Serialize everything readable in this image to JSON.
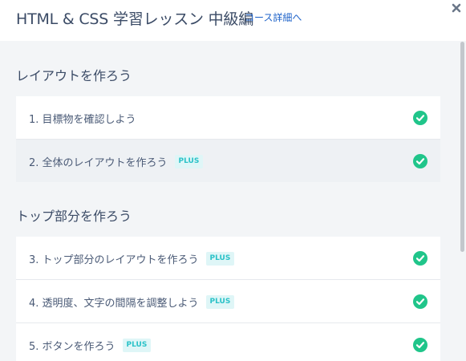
{
  "header": {
    "title": "HTML & CSS 学習レッスン 中級編",
    "course_link": "コース詳細へ",
    "close_icon": "close-icon"
  },
  "colors": {
    "accent_link": "#1f63c9",
    "check_green": "#20c58a",
    "plus_badge_text": "#2bc2c8",
    "plus_badge_bg": "#dff6f7"
  },
  "chapters": [
    {
      "title": "レイアウトを作ろう",
      "lessons": [
        {
          "label": "1. 目標物を確認しよう",
          "plus": "",
          "status_icon": "check-circle-icon"
        },
        {
          "label": "2. 全体のレイアウトを作ろう",
          "plus": "PLUS",
          "status_icon": "check-circle-icon"
        }
      ]
    },
    {
      "title": "トップ部分を作ろう",
      "lessons": [
        {
          "label": "3. トップ部分のレイアウトを作ろう",
          "plus": "PLUS",
          "status_icon": "check-circle-icon"
        },
        {
          "label": "4. 透明度、文字の間隔を調整しよう",
          "plus": "PLUS",
          "status_icon": "check-circle-icon"
        },
        {
          "label": "5. ボタンを作ろう",
          "plus": "PLUS",
          "status_icon": "check-circle-icon"
        }
      ]
    }
  ]
}
